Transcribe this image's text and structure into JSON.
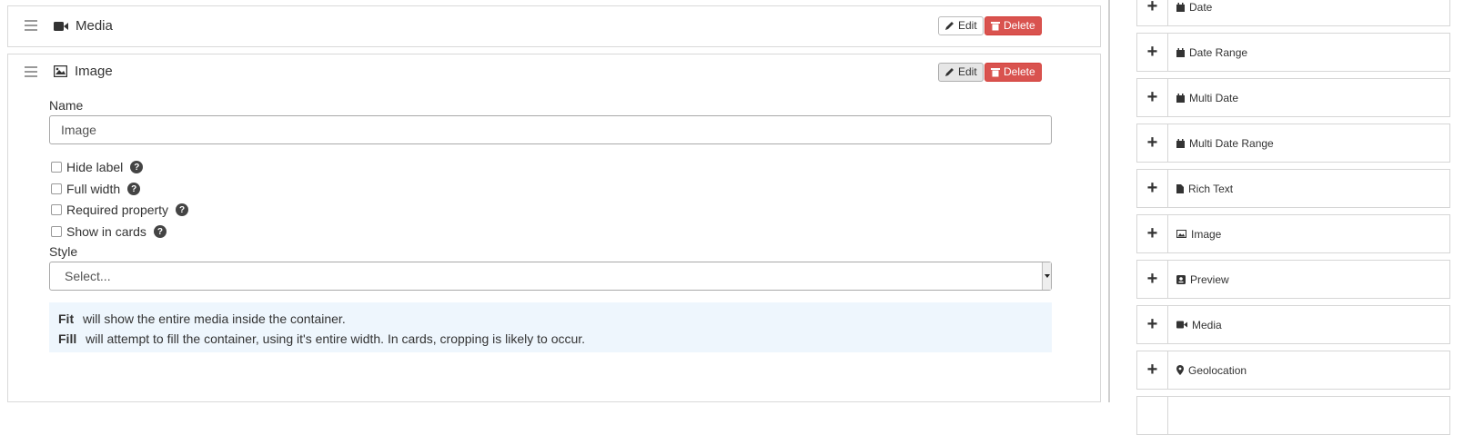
{
  "cards": {
    "media": {
      "title": "Media",
      "edit_label": "Edit",
      "delete_label": "Delete"
    },
    "image": {
      "title": "Image",
      "edit_label": "Edit",
      "delete_label": "Delete",
      "name_label": "Name",
      "name_value": "Image",
      "checkboxes": [
        {
          "label": "Hide label",
          "checked": false
        },
        {
          "label": "Full width",
          "checked": false
        },
        {
          "label": "Required property",
          "checked": false
        },
        {
          "label": "Show in cards",
          "checked": false
        }
      ],
      "style_label": "Style",
      "style_value": "Select...",
      "info": [
        {
          "term": "Fit",
          "text": "will show the entire media inside the container."
        },
        {
          "term": "Fill",
          "text": "will attempt to fill the container, using it's entire width. In cards, cropping is likely to occur."
        }
      ]
    }
  },
  "field_types": [
    {
      "label": "Date",
      "icon": "calendar-icon"
    },
    {
      "label": "Date Range",
      "icon": "calendar-icon"
    },
    {
      "label": "Multi Date",
      "icon": "calendar-icon"
    },
    {
      "label": "Multi Date Range",
      "icon": "calendar-icon"
    },
    {
      "label": "Rich Text",
      "icon": "file-icon"
    },
    {
      "label": "Image",
      "icon": "image-icon"
    },
    {
      "label": "Preview",
      "icon": "preview-icon"
    },
    {
      "label": "Media",
      "icon": "video-camera-icon"
    },
    {
      "label": "Geolocation",
      "icon": "map-marker-icon"
    }
  ],
  "colors": {
    "delete": "#d9534f",
    "info_bg": "#eef6fd",
    "border": "#d9d9d9"
  }
}
